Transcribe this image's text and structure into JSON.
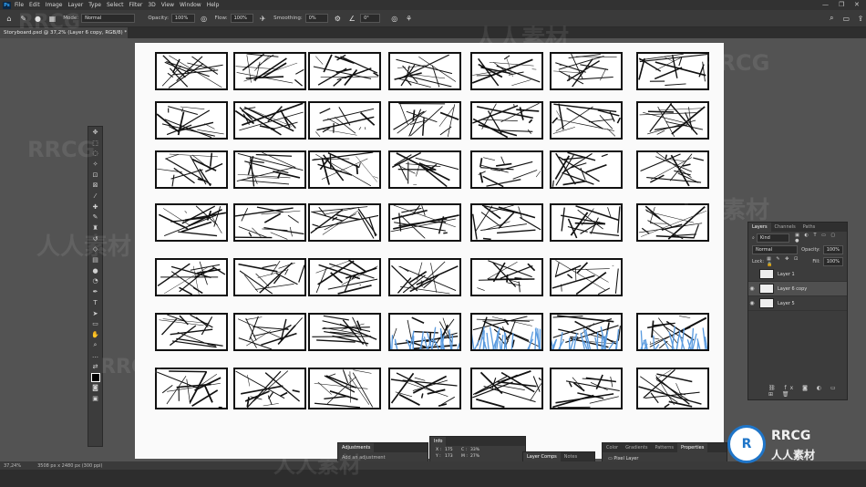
{
  "menubar": {
    "items": [
      "File",
      "Edit",
      "Image",
      "Layer",
      "Type",
      "Select",
      "Filter",
      "3D",
      "View",
      "Window",
      "Help"
    ]
  },
  "options": {
    "mode_label": "Mode:",
    "mode_value": "Normal",
    "opacity_label": "Opacity:",
    "opacity_value": "100%",
    "flow_label": "Flow:",
    "flow_value": "100%",
    "smoothing_label": "Smoothing:",
    "smoothing_value": "0%",
    "angle_value": "0°"
  },
  "document": {
    "tab_title": "Storyboard.psd @ 37,2% (Layer 6 copy, RGB/8) *"
  },
  "tools": [
    "move-icon",
    "marquee-icon",
    "lasso-icon",
    "magic-wand-icon",
    "crop-icon",
    "frame-icon",
    "eyedropper-icon",
    "healing-icon",
    "brush-icon",
    "stamp-icon",
    "history-brush-icon",
    "eraser-icon",
    "gradient-icon",
    "blur-icon",
    "dodge-icon",
    "pen-icon",
    "type-icon",
    "path-select-icon",
    "shape-icon",
    "hand-icon",
    "zoom-icon",
    "more-tools-icon",
    "swap-colors-icon",
    "foreground-color-icon",
    "quick-mask-icon",
    "screen-mode-icon"
  ],
  "layers_panel": {
    "tabs": [
      "Layers",
      "Channels",
      "Paths"
    ],
    "kind_label": "Kind",
    "blend_mode": "Normal",
    "opacity_label": "Opacity:",
    "opacity_value": "100%",
    "lock_label": "Lock:",
    "fill_label": "Fill:",
    "fill_value": "100%",
    "layers": [
      {
        "name": "Layer 1",
        "visible": false,
        "selected": false
      },
      {
        "name": "Layer 6 copy",
        "visible": true,
        "selected": true
      },
      {
        "name": "Layer 5",
        "visible": true,
        "selected": false
      }
    ]
  },
  "adjustments_panel": {
    "title": "Adjustments",
    "hint": "Add an adjustment"
  },
  "info_panel": {
    "title": "Info",
    "x_label": "X :",
    "x_value": "175",
    "y_label": "Y :",
    "y_value": "173",
    "c_label": "C :",
    "c_value": "33%",
    "m_label": "M :",
    "m_value": "27%"
  },
  "comps_panel": {
    "tabs": [
      "Layer Comps",
      "Notes"
    ]
  },
  "properties_panel": {
    "tabs": [
      "Color",
      "Gradients",
      "Patterns",
      "Properties"
    ],
    "row_label": "Pixel Layer"
  },
  "status": {
    "zoom": "37,24%",
    "doc_info": "3508 px x 2480 px (300 ppi)"
  },
  "watermark": {
    "latin": "RRCG",
    "cjk": "人人素材"
  },
  "brand": {
    "name": "RRCG",
    "sub": "人人素材",
    "accent": "#1f75c8"
  },
  "colors": {
    "blue_sketch": "#5a9be0",
    "ink": "#111111"
  }
}
